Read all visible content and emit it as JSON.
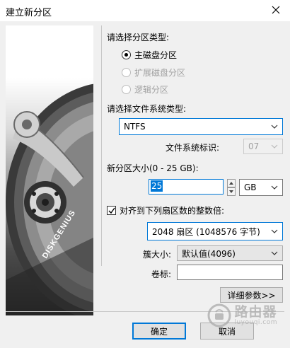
{
  "window": {
    "title": "建立新分区",
    "close_icon": "close-icon"
  },
  "artwork": {
    "brand_text": "DISKGENIUS"
  },
  "partition_type": {
    "label": "请选择分区类型:",
    "options": [
      {
        "label": "主磁盘分区",
        "selected": true,
        "enabled": true
      },
      {
        "label": "扩展磁盘分区",
        "selected": false,
        "enabled": false
      },
      {
        "label": "逻辑分区",
        "selected": false,
        "enabled": false
      }
    ]
  },
  "filesystem": {
    "label": "请选择文件系统类型:",
    "value": "NTFS",
    "id_label": "文件系统标识:",
    "id_value": "07"
  },
  "size": {
    "label": "新分区大小(0 - 25 GB):",
    "value": "25",
    "unit": "GB"
  },
  "align": {
    "checked": true,
    "label": "对齐到下列扇区数的整数倍:",
    "value": "2048 扇区 (1048576 字节)"
  },
  "cluster": {
    "label": "簇大小:",
    "value": "默认值(4096)"
  },
  "volume": {
    "label": "卷标:",
    "value": ""
  },
  "buttons": {
    "details": "详细参数>>",
    "ok": "确定",
    "cancel": "取消"
  },
  "watermark": {
    "big": "路由器",
    "small": "luyouqi.com"
  }
}
